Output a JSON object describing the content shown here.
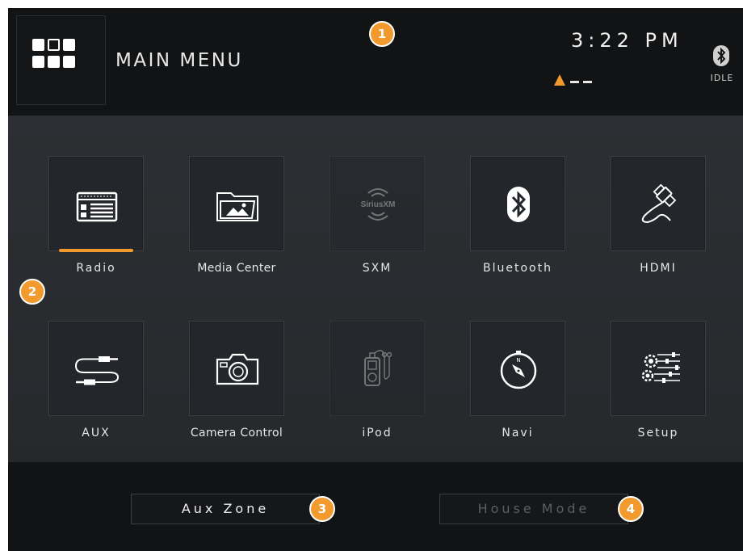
{
  "header": {
    "title": "MAIN MENU",
    "time": "3:22 PM",
    "bluetooth_status": "IDLE"
  },
  "tiles": [
    {
      "label": "Radio",
      "icon": "radio-icon",
      "selected": true
    },
    {
      "label": "Media Center",
      "icon": "folder-image-icon"
    },
    {
      "label": "SXM",
      "icon": "siriusxm-icon",
      "logo_text": "SiriusXM",
      "disabled": true
    },
    {
      "label": "Bluetooth",
      "icon": "bluetooth-icon"
    },
    {
      "label": "HDMI",
      "icon": "hdmi-cable-icon"
    },
    {
      "label": "AUX",
      "icon": "aux-cable-icon"
    },
    {
      "label": "Camera Control",
      "icon": "camera-icon"
    },
    {
      "label": "iPod",
      "icon": "ipod-icon",
      "disabled": true
    },
    {
      "label": "Navi",
      "icon": "compass-icon",
      "compass_letter": "N"
    },
    {
      "label": "Setup",
      "icon": "settings-sliders-icon"
    }
  ],
  "footer": {
    "aux_zone": "Aux Zone",
    "house_mode": "House Mode"
  },
  "callouts": [
    "1",
    "2",
    "3",
    "4"
  ],
  "colors": {
    "accent": "#f29a2e",
    "background": "#141516",
    "panel": "#2a2d31",
    "text": "#e6e6e6",
    "disabled_text": "#5b5e62"
  }
}
